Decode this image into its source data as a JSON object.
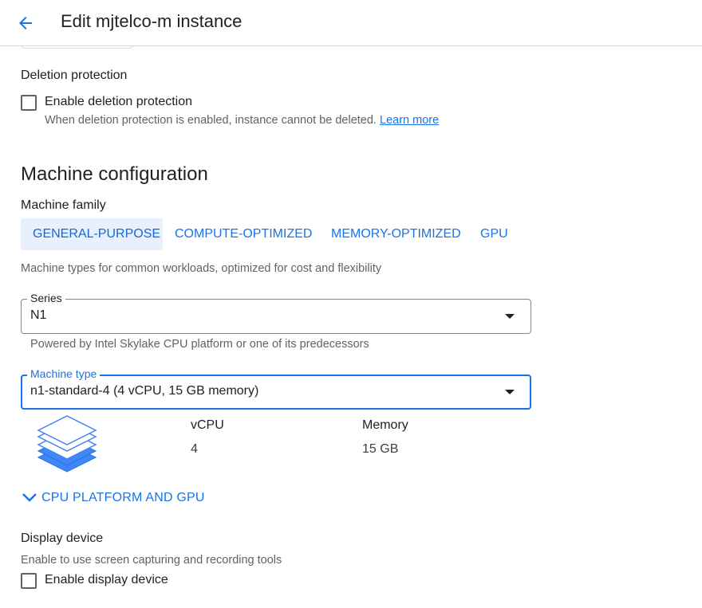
{
  "header": {
    "title": "Edit mjtelco-m instance",
    "back_label": "Back"
  },
  "deletion_protection": {
    "heading": "Deletion protection",
    "checkbox_label": "Enable deletion protection",
    "checked": false,
    "help_text": "When deletion protection is enabled, instance cannot be deleted.",
    "learn_more": "Learn more"
  },
  "machine_config": {
    "title": "Machine configuration",
    "family_label": "Machine family",
    "tabs": [
      {
        "label": "GENERAL-PURPOSE",
        "active": true
      },
      {
        "label": "COMPUTE-OPTIMIZED",
        "active": false
      },
      {
        "label": "MEMORY-OPTIMIZED",
        "active": false
      },
      {
        "label": "GPU",
        "active": false
      }
    ],
    "family_description": "Machine types for common workloads, optimized for cost and flexibility",
    "series": {
      "label": "Series",
      "value": "N1",
      "help": "Powered by Intel Skylake CPU platform or one of its predecessors"
    },
    "machine_type": {
      "label": "Machine type",
      "value": "n1-standard-4 (4 vCPU, 15 GB memory)"
    },
    "specs": {
      "vcpu_label": "vCPU",
      "vcpu_value": "4",
      "memory_label": "Memory",
      "memory_value": "15 GB"
    },
    "cpu_platform_toggle": "CPU PLATFORM AND GPU"
  },
  "display_device": {
    "heading": "Display device",
    "help_text": "Enable to use screen capturing and recording tools",
    "checkbox_label": "Enable display device",
    "checked": false
  },
  "colors": {
    "accent": "#1a73e8",
    "active_tab_bg": "#e8f0fe",
    "text": "#202124",
    "muted": "#5f6368"
  }
}
